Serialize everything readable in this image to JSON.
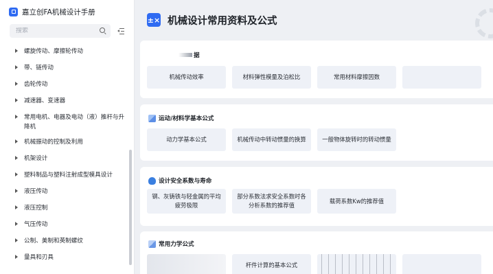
{
  "sidebar": {
    "app_title": "嘉立创FA机械设计手册",
    "search_placeholder": "搜索",
    "items": [
      {
        "label": "螺旋传动、摩擦轮传动"
      },
      {
        "label": "带、链传动"
      },
      {
        "label": "齿轮传动"
      },
      {
        "label": "减速器、变速器"
      },
      {
        "label": "常用电机、电器及电动（液）推杆与升降机"
      },
      {
        "label": "机械振动的控制及利用"
      },
      {
        "label": "机架设计"
      },
      {
        "label": "塑料制品与塑料注射成型模具设计"
      },
      {
        "label": "液压传动"
      },
      {
        "label": "液压控制"
      },
      {
        "label": "气压传动"
      },
      {
        "label": "公制、美制和英制螺纹"
      },
      {
        "label": "量具和刃具"
      }
    ]
  },
  "header": {
    "icon_glyph": "±×",
    "title": "机械设计常用资料及公式"
  },
  "sections": [
    {
      "title": "据",
      "icon": "",
      "tiles": [
        "机械传动效率",
        "材料弹性模量及泊松比",
        "常用材料摩擦因数",
        ""
      ]
    },
    {
      "title": "运动/材料学基本公式",
      "icon": "cube-icon",
      "tiles": [
        "动力学基本公式",
        "机械传动中转动惯量的换算",
        "一般物体旋转时的转动惯量"
      ]
    },
    {
      "title": "设计安全系数与寿命",
      "icon": "shield-icon",
      "tiles": [
        "钢、灰铸铁与轻金属的平均疲劳极限",
        "部分系数法求安全系数时各分析系数的推荐值",
        "载荷系数Kw的推荐值"
      ]
    },
    {
      "title": "常用力学公式",
      "icon": "cube-icon",
      "tiles": [
        "",
        "杆件计算的基本公式",
        "",
        ""
      ]
    }
  ],
  "colors": {
    "accent": "#2f6bf2",
    "tile_bg": "#eef1f7",
    "page_bg": "#eef0f4"
  }
}
